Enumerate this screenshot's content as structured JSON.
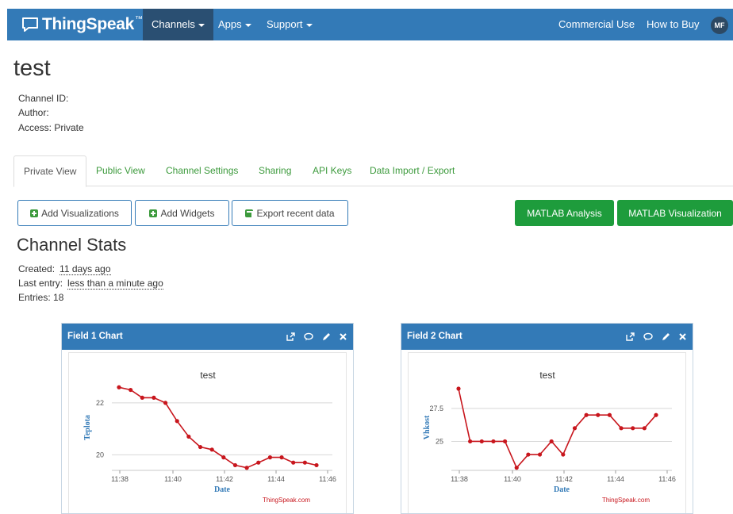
{
  "nav": {
    "brand": "ThingSpeak",
    "brand_tm": "™",
    "items": [
      {
        "label": "Channels",
        "active": true,
        "dropdown": true
      },
      {
        "label": "Apps",
        "active": false,
        "dropdown": true
      },
      {
        "label": "Support",
        "active": false,
        "dropdown": true
      }
    ],
    "right_items": [
      {
        "label": "Commercial Use"
      },
      {
        "label": "How to Buy"
      }
    ],
    "avatar": "MF"
  },
  "channel": {
    "title": "test",
    "id_label": "Channel ID:",
    "author_label": "Author:",
    "access_label": "Access: Private"
  },
  "tabs": [
    "Private View",
    "Public View",
    "Channel Settings",
    "Sharing",
    "API Keys",
    "Data Import / Export"
  ],
  "buttons": {
    "add_visualizations": "Add Visualizations",
    "add_widgets": "Add Widgets",
    "export_recent": "Export recent data",
    "matlab_analysis": "MATLAB Analysis",
    "matlab_visualization": "MATLAB Visualization"
  },
  "stats": {
    "title": "Channel Stats",
    "created_label": "Created:",
    "created_value": "11 days ago",
    "last_entry_label": "Last entry:",
    "last_entry_value": "less than a minute ago",
    "entries": "Entries: 18"
  },
  "colors": {
    "navbar": "#337ab7",
    "nav_active": "#2a4f72",
    "tab_link": "#3c9a3c",
    "matlab_green": "#1e9c3c",
    "series": "#c8161d",
    "axis_label": "#337ab7"
  },
  "chart_data": [
    {
      "panel_title": "Field 1 Chart",
      "type": "line",
      "title": "test",
      "xlabel": "Date",
      "ylabel": "Teplota",
      "xticks": [
        "11:38",
        "11:40",
        "11:42",
        "11:44",
        "11:46"
      ],
      "yticks": [
        20,
        22
      ],
      "ylim": [
        19.4,
        22.7
      ],
      "xlim_minutes": [
        11.0,
        46.3
      ],
      "x_minutes": [
        37.3,
        37.7,
        38.2,
        38.6,
        39.1,
        39.5,
        40.0,
        40.4,
        40.9,
        41.3,
        41.8,
        42.2,
        42.7,
        43.1,
        43.6,
        44.0,
        44.5,
        44.9,
        45.3,
        45.8
      ],
      "values": [
        22.6,
        22.5,
        22.2,
        22.2,
        22.0,
        21.3,
        20.7,
        20.3,
        20.2,
        19.9,
        19.6,
        19.5,
        19.7,
        19.9,
        19.9,
        19.7,
        19.7,
        19.6
      ],
      "source_label": "ThingSpeak.com",
      "grid": true
    },
    {
      "panel_title": "Field 2 Chart",
      "type": "line",
      "title": "test",
      "xlabel": "Date",
      "ylabel": "Vhkost",
      "xticks": [
        "11:38",
        "11:40",
        "11:42",
        "11:44",
        "11:46"
      ],
      "yticks": [
        25,
        27.5
      ],
      "values": [
        29,
        25,
        25,
        25,
        25,
        23,
        24,
        24,
        25,
        24,
        26,
        27,
        27,
        27,
        26,
        26,
        26,
        27
      ],
      "ylim": [
        22.8,
        29.3
      ],
      "source_label": "ThingSpeak.com",
      "grid": true
    }
  ]
}
